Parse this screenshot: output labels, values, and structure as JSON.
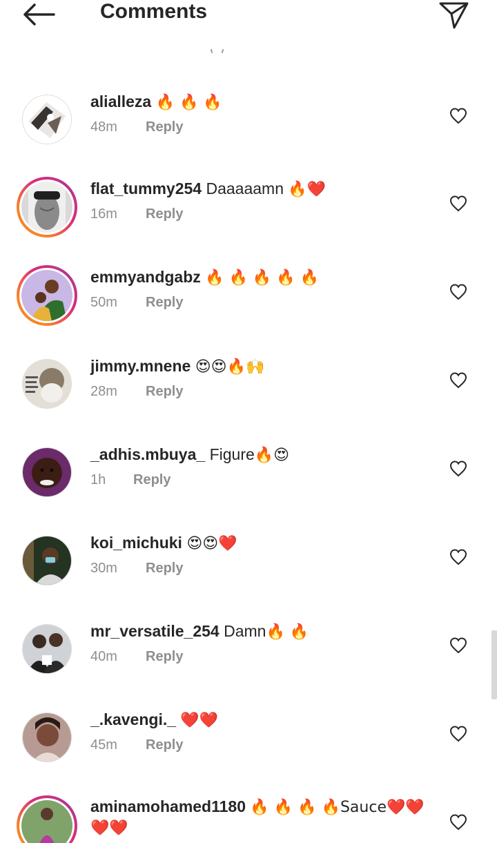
{
  "header": {
    "title": "Comments",
    "back_icon": "arrow-left-icon",
    "share_icon": "paper-plane-icon"
  },
  "comments": [
    {
      "username": "alialleza",
      "text": "",
      "emoji": "🔥 🔥 🔥",
      "time": "48m",
      "reply": "Reply",
      "ring": false
    },
    {
      "username": "flat_tummy254",
      "text": " Daaaaamn ",
      "emoji": "🔥❤️",
      "time": "16m",
      "reply": "Reply",
      "ring": true
    },
    {
      "username": "emmyandgabz",
      "text": "",
      "emoji": "🔥 🔥 🔥 🔥 🔥",
      "time": "50m",
      "reply": "Reply",
      "ring": true
    },
    {
      "username": "jimmy.mnene",
      "text": "",
      "emoji": "😍😍🔥🙌",
      "time": "28m",
      "reply": "Reply",
      "ring": false
    },
    {
      "username": "_adhis.mbuya_",
      "text": " Figure",
      "emoji": "🔥😍",
      "time": "1h",
      "reply": "Reply",
      "ring": false
    },
    {
      "username": "koi_michuki",
      "text": "",
      "emoji": "😍😍❤️",
      "time": "30m",
      "reply": "Reply",
      "ring": false
    },
    {
      "username": "mr_versatile_254",
      "text": " Damn",
      "emoji": "🔥 🔥",
      "time": "40m",
      "reply": "Reply",
      "ring": false
    },
    {
      "username": "_.kavengi._",
      "text": "",
      "emoji": "❤️❤️",
      "time": "45m",
      "reply": "Reply",
      "ring": false
    },
    {
      "username": "aminamohamed1180",
      "text": "",
      "emoji": "🔥 🔥 🔥 🔥Sauce❤️❤️ ❤️❤️",
      "time": "",
      "reply": "",
      "ring": true
    }
  ],
  "colors": {
    "text": "#262626",
    "muted": "#8e8e8e",
    "heart_outline": "#262626",
    "story_ring_start": "#f58529",
    "story_ring_end": "#c13584"
  },
  "heart_icon": "heart-outline-icon"
}
